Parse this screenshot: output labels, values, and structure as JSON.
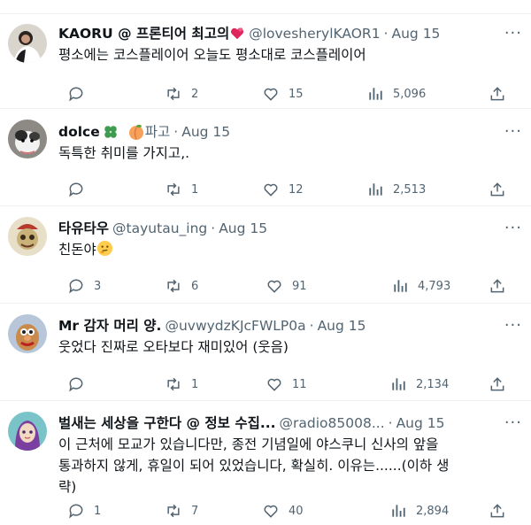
{
  "tweets": [
    {
      "name": "KAORU @ 프론티어 최고의",
      "handle": "@lovesherylKAOR1",
      "separator": "·",
      "date": "Aug 15",
      "text": "평소에는 코스플레이어 오늘도 평소대로 코스플레이어",
      "replies": "",
      "retweets": "2",
      "likes": "15",
      "views": "5,096"
    },
    {
      "name": "dolce",
      "handle": "파고",
      "separator": "·",
      "date": "Aug 15",
      "text": "독특한 취미를 가지고,.",
      "replies": "",
      "retweets": "1",
      "likes": "12",
      "views": "2,513"
    },
    {
      "name": "타유타우",
      "handle": "@tayutau_ing",
      "separator": "·",
      "date": "Aug 15",
      "text": "친돈야",
      "replies": "3",
      "retweets": "6",
      "likes": "91",
      "views": "4,793"
    },
    {
      "name": "Mr 감자 머리 양.",
      "handle": "@uvwydzKJcFWLP0a",
      "separator": "·",
      "date": "Aug 15",
      "text": "웃었다 진짜로 오타보다 재미있어 (웃음)",
      "replies": "",
      "retweets": "1",
      "likes": "11",
      "views": "2,134"
    },
    {
      "name": "벌새는 세상을 구한다 @ 정보 수집...",
      "handle": "@radio85008...",
      "separator": "·",
      "date": "Aug 15",
      "text_lines": [
        "이 근처에 모교가 있습니다만, 종전 기념일에 야스쿠니 신사의 앞을",
        "통과하지 않게, 휴일이 되어 있었습니다, 확실히. 이유는......(이하 생",
        "략)"
      ],
      "replies": "1",
      "retweets": "7",
      "likes": "40",
      "views": "2,894"
    }
  ],
  "icons": {
    "more": "more-icon",
    "reply": "reply-icon",
    "retweet": "retweet-icon",
    "like": "heart-icon",
    "views": "views-icon",
    "share": "share-icon"
  },
  "more_glyph": "···",
  "colors": {
    "text": "#0f1419",
    "secondary": "#536471",
    "divider": "#eff3f4"
  }
}
